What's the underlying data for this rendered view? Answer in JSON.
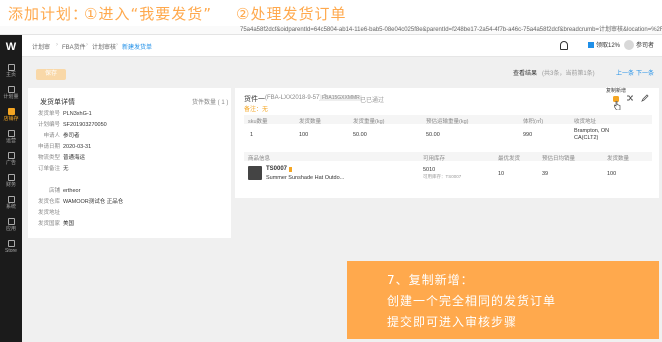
{
  "captions": {
    "title": "添加计划：",
    "step1": "①进入“我要发货”",
    "step2": "②处理发货订单"
  },
  "browser": {
    "url": "75a4a58f2dcf&oidparentId=64c5804-ab14-11e6-bab5-08e04c025f8e&parentId=f248be17-2a54-4f7b-a46c-75a4a58f2dcf&breadcrumb=计划审核&location=%2Fsh..."
  },
  "sidebar": {
    "items": [
      {
        "label": "主页"
      },
      {
        "label": "计划量"
      },
      {
        "label": "店铺存"
      },
      {
        "label": "运营"
      },
      {
        "label": "广告"
      },
      {
        "label": "财务"
      },
      {
        "label": "系统"
      },
      {
        "label": "应用"
      },
      {
        "label": "Store"
      }
    ]
  },
  "header": {
    "breadcrumbs": [
      "计划审",
      "FBA货件",
      "计划审核",
      "新建发货单"
    ],
    "account_btn": "领取12%",
    "user": "参司者"
  },
  "toolbar": {
    "left_button": "保存",
    "right_title": "查看结果",
    "right_sub": "(共3条，当前第1条)",
    "prev": "上一条",
    "next": "下一条"
  },
  "left_panel": {
    "title": "发货单详情",
    "count_label": "货件数量 ( 1 )",
    "fields": [
      {
        "label": "发货单号",
        "value": "PLN3xhG-1"
      },
      {
        "label": "计划编号",
        "value": "SF201903270050"
      },
      {
        "label": "申请人",
        "value": "参司者"
      },
      {
        "label": "申请日期",
        "value": "2020-03-31"
      },
      {
        "label": "物流类型",
        "value": "普通海运"
      },
      {
        "label": "订单备注",
        "value": "无"
      }
    ],
    "fields2": [
      {
        "label": "店铺",
        "value": "ertheor"
      },
      {
        "label": "发货仓库",
        "value": "WAMOOR测试仓 正品仓"
      },
      {
        "label": "发货地址",
        "value": ""
      },
      {
        "label": "发货国家",
        "value": "美国"
      }
    ]
  },
  "shipment": {
    "title": "货件一",
    "code": "(FBA-LXX2018-9-57)-5",
    "tag": "FBA15GXXMMR",
    "status": "已已通过",
    "note": "备注：无",
    "tooltip": "复制新增",
    "table1": {
      "headers": [
        "sku数量",
        "发货数量",
        "发货重量(kg)",
        "预估运输重量(kg)",
        "体积(㎥)",
        "收货地址"
      ],
      "row": [
        "1",
        "100",
        "50.00",
        "50.00",
        "990",
        "Brampton, ON CA(CLT2)"
      ]
    },
    "table2": {
      "headers": [
        "商品信息",
        "可用库存",
        "最优发货",
        "预估日均销量",
        "发货数量"
      ],
      "sku": "TS0007",
      "product": "Summer Sunshade Hat Outdo...",
      "stock_main": "5010",
      "stock_sub": "可用库存：TS0007",
      "optimal": "10",
      "daily": "39",
      "qty": "100"
    }
  },
  "overlay": {
    "line1": "7、复制新增：",
    "line2": "创建一个完全相同的发货订单",
    "line3": "提交即可进入审核步骤"
  },
  "colors": {
    "accent": "#ffa94d",
    "sidebar": "#1b1b1b",
    "link": "#1f8fe8"
  }
}
